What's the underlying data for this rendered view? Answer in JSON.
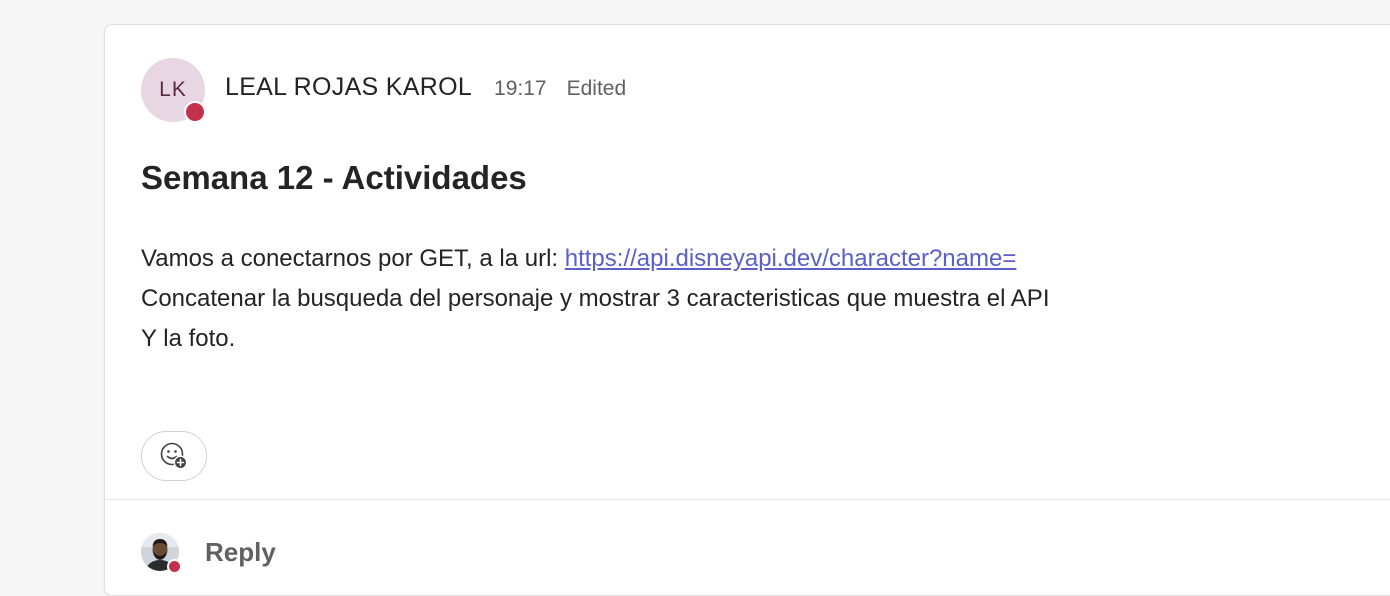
{
  "post": {
    "author": {
      "initials": "LK",
      "name": "LEAL ROJAS KAROL",
      "avatar_color": "#e8d6e2",
      "presence": "busy",
      "presence_color": "#c4314b"
    },
    "time": "19:17",
    "edited_label": "Edited",
    "subject": "Semana 12 - Actividades",
    "body": {
      "line1_prefix": "Vamos a conectarnos por GET, a la url: ",
      "link_text": "https://api.disneyapi.dev/character?name=",
      "line2": "Concatenar la busqueda del personaje y mostrar 3 caracteristicas que muestra el API",
      "line3": "Y la foto."
    },
    "reaction_button_icon": "add-emoji-icon",
    "link_color": "#5b5fc7"
  },
  "reply": {
    "label": "Reply",
    "avatar_icon": "user-photo-icon"
  }
}
